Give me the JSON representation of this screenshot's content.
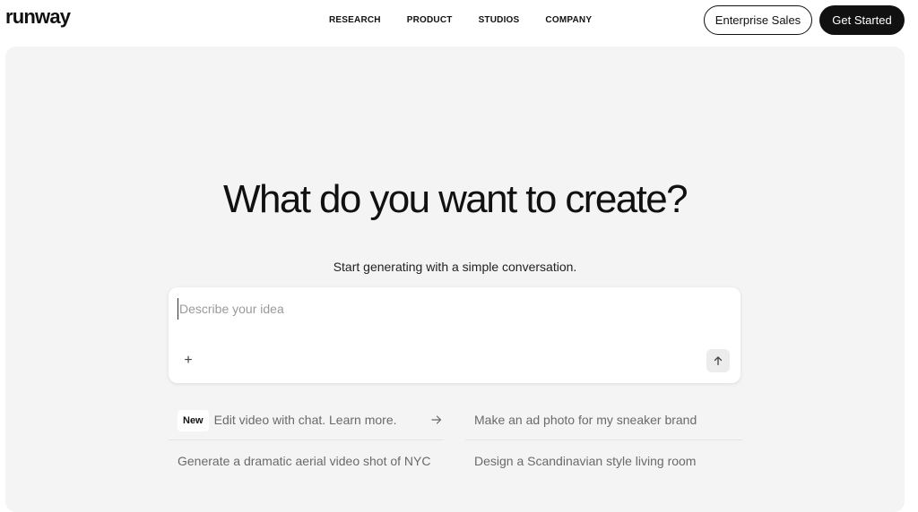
{
  "nav": {
    "logo": "runway",
    "links": [
      "RESEARCH",
      "PRODUCT",
      "STUDIOS",
      "COMPANY"
    ],
    "enterprise_label": "Enterprise Sales",
    "get_started_label": "Get Started"
  },
  "hero": {
    "headline": "What do you want to create?",
    "subline": "Start generating with a simple conversation."
  },
  "prompt": {
    "placeholder": "Describe your idea",
    "plus_label": "+"
  },
  "suggestions": {
    "featured_badge": "New",
    "featured_text": "Edit video with chat. Learn more.",
    "item2": "Make an ad photo for my sneaker brand",
    "item3": "Generate a dramatic aerial video shot of NYC",
    "item4": "Design a Scandinavian style living room"
  },
  "icons": {
    "send": "arrow-up-icon",
    "featured_arrow": "arrow-right-icon",
    "attach": "plus-icon"
  },
  "colors": {
    "accent": "#111111",
    "hero_bg": "#f4f4f4"
  }
}
